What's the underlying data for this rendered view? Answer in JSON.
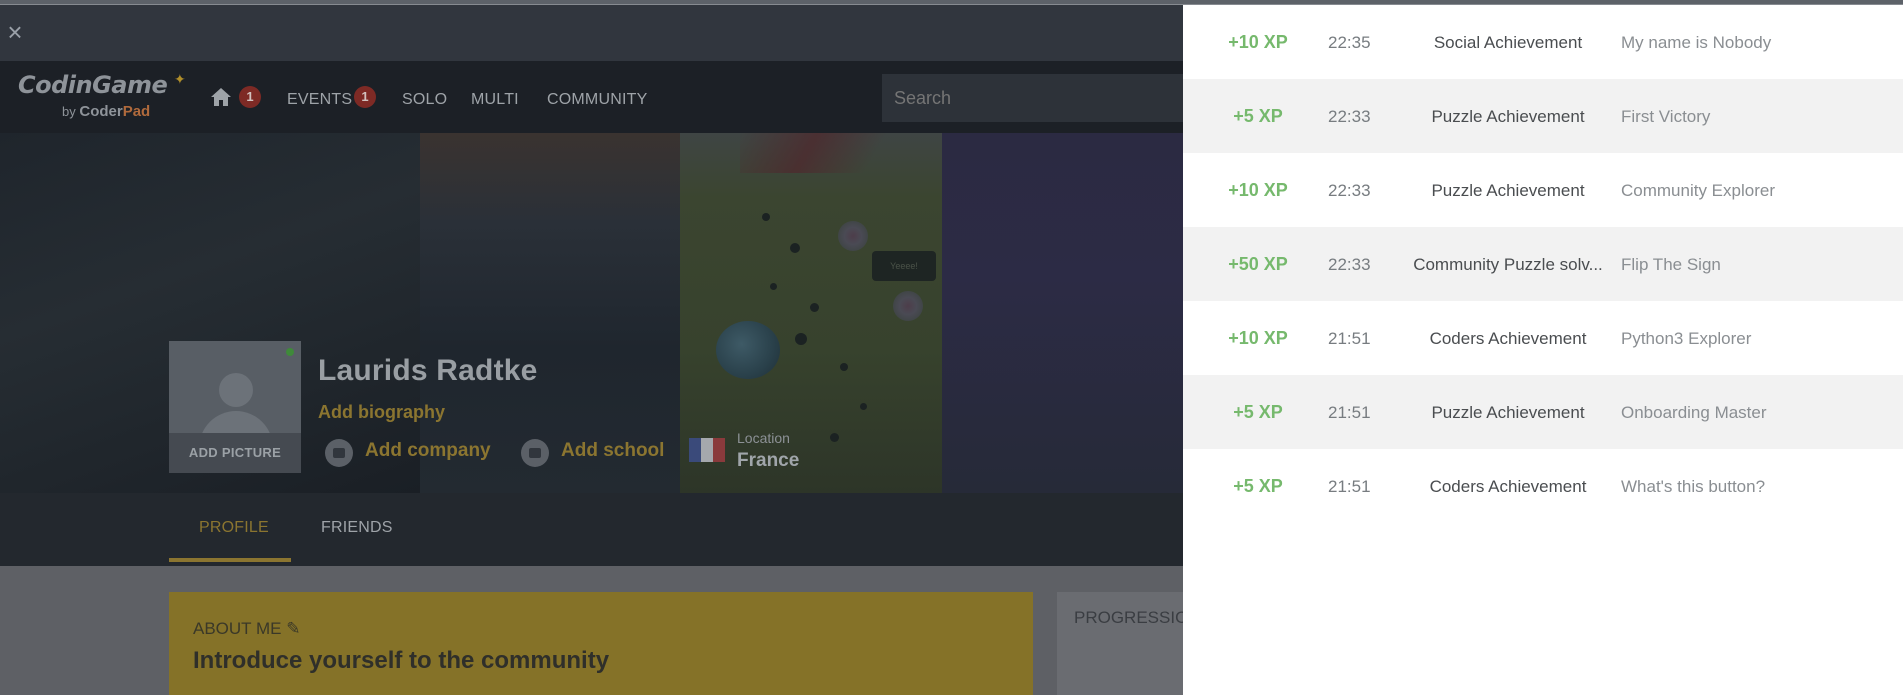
{
  "app": {
    "logo": {
      "name": "CodinGame",
      "by": "by",
      "brand": "Coder",
      "brand_pad": "Pad"
    },
    "nav": {
      "home_badge": "1",
      "events_label": "EVENTS",
      "events_badge": "1",
      "solo_label": "SOLO",
      "multi_label": "MULTI",
      "community_label": "COMMUNITY",
      "search_placeholder": "Search"
    },
    "banner": {
      "speech_text": "Yeeee!"
    },
    "profile": {
      "name": "Laurids Radtke",
      "add_picture": "ADD PICTURE",
      "add_biography": "Add biography",
      "add_company": "Add company",
      "add_school": "Add school",
      "location_label": "Location",
      "location_value": "France"
    },
    "tabs": {
      "profile": "PROFILE",
      "friends": "FRIENDS"
    },
    "about": {
      "label": "ABOUT ME",
      "title": "Introduce yourself to the community"
    },
    "progression": {
      "label": "PROGRESSION"
    }
  },
  "notifications": [
    {
      "xp": "+10 XP",
      "time": "22:35",
      "category": "Social Achievement",
      "title": "My name is Nobody"
    },
    {
      "xp": "+5 XP",
      "time": "22:33",
      "category": "Puzzle Achievement",
      "title": "First Victory"
    },
    {
      "xp": "+10 XP",
      "time": "22:33",
      "category": "Puzzle Achievement",
      "title": "Community Explorer"
    },
    {
      "xp": "+50 XP",
      "time": "22:33",
      "category": "Community Puzzle solv...",
      "title": "Flip The Sign"
    },
    {
      "xp": "+10 XP",
      "time": "21:51",
      "category": "Coders Achievement",
      "title": "Python3 Explorer"
    },
    {
      "xp": "+5 XP",
      "time": "21:51",
      "category": "Puzzle Achievement",
      "title": "Onboarding Master"
    },
    {
      "xp": "+5 XP",
      "time": "21:51",
      "category": "Coders Achievement",
      "title": "What's this button?"
    }
  ],
  "colors": {
    "xp_green": "#76b96d",
    "accent_gold": "#f2c40d",
    "badge_red": "#e53935"
  }
}
